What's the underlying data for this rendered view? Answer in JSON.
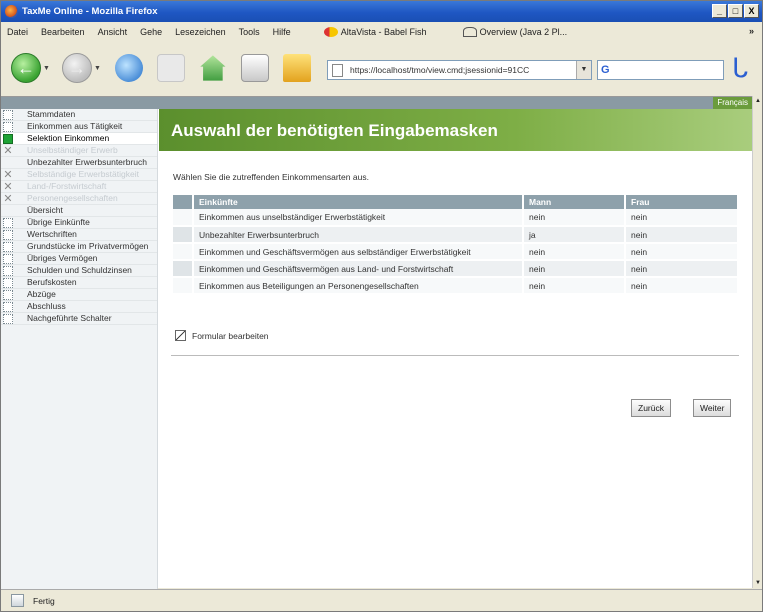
{
  "window": {
    "title": "TaxMe Online - Mozilla Firefox",
    "controls": [
      "_",
      "□",
      "X"
    ]
  },
  "menu": {
    "items": [
      "Datei",
      "Bearbeiten",
      "Ansicht",
      "Gehe",
      "Lesezeichen",
      "Tools",
      "Hilfe"
    ],
    "bookmarks": [
      "AltaVista - Babel Fish",
      "Overview (Java 2 Pl..."
    ],
    "overflow": "»"
  },
  "nav": {
    "url": "https://localhost/tmo/view.cmd;jsessionid=91CC",
    "search_glyph": "G",
    "throbber_glyph": "ᒐ"
  },
  "page": {
    "language_link": "Français",
    "banner_title": "Auswahl der benötigten Eingabemasken",
    "intro": "Wählen Sie die zutreffenden Einkommensarten aus.",
    "table": {
      "headers": [
        "Einkünfte",
        "Mann",
        "Frau"
      ],
      "rows": [
        [
          "Einkommen aus unselbständiger Erwerbstätigkeit",
          "nein",
          "nein"
        ],
        [
          "Unbezahlter Erwerbsunterbruch",
          "ja",
          "nein"
        ],
        [
          "Einkommen und Geschäftsvermögen aus selbständiger Erwerbstätigkeit",
          "nein",
          "nein"
        ],
        [
          "Einkommen und Geschäftsvermögen aus Land- und Forstwirtschaft",
          "nein",
          "nein"
        ],
        [
          "Einkommen aus Beteiligungen an Personengesellschaften",
          "nein",
          "nein"
        ]
      ]
    },
    "edit_form": "Formular bearbeiten",
    "back_button": "Zurück",
    "next_button": "Weiter"
  },
  "sidebar": {
    "items": [
      {
        "label": "Stammdaten",
        "mark": "box",
        "state": "normal"
      },
      {
        "label": "Einkommen aus Tätigkeit",
        "mark": "box",
        "state": "normal"
      },
      {
        "label": "Selektion Einkommen",
        "mark": "check",
        "state": "selected"
      },
      {
        "label": "Unselbständiger Erwerb",
        "mark": "x",
        "state": "disabled"
      },
      {
        "label": "Unbezahlter Erwerbsunterbruch",
        "mark": "none",
        "state": "normal"
      },
      {
        "label": "Selbständige Erwerbstätigkeit",
        "mark": "x",
        "state": "disabled"
      },
      {
        "label": "Land-/Forstwirtschaft",
        "mark": "x",
        "state": "disabled"
      },
      {
        "label": "Personengesellschaften",
        "mark": "x",
        "state": "disabled"
      },
      {
        "label": "Übersicht",
        "mark": "none",
        "state": "normal"
      },
      {
        "label": "Übrige Einkünfte",
        "mark": "box",
        "state": "normal"
      },
      {
        "label": "Wertschriften",
        "mark": "box",
        "state": "normal"
      },
      {
        "label": "Grundstücke im Privatvermögen",
        "mark": "box",
        "state": "normal"
      },
      {
        "label": "Übriges Vermögen",
        "mark": "box",
        "state": "normal"
      },
      {
        "label": "Schulden und Schuldzinsen",
        "mark": "box",
        "state": "normal"
      },
      {
        "label": "Berufskosten",
        "mark": "box",
        "state": "normal"
      },
      {
        "label": "Abzüge",
        "mark": "box",
        "state": "normal"
      },
      {
        "label": "Abschluss",
        "mark": "box",
        "state": "normal"
      },
      {
        "label": "Nachgeführte Schalter",
        "mark": "box",
        "state": "normal"
      }
    ]
  },
  "status": {
    "text": "Fertig"
  },
  "colors": {
    "banner": "#5b8f2d",
    "table_header": "#8ea1ab",
    "selected_check": "#1ea335"
  }
}
